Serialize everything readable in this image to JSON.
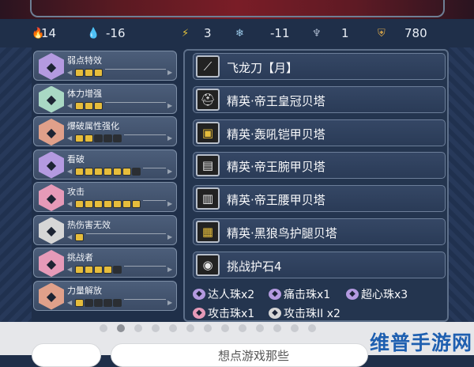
{
  "stats": [
    {
      "icon": "fire-icon",
      "glyph": "🔥",
      "value": "14",
      "color": "#e0413a"
    },
    {
      "icon": "water-icon",
      "glyph": "💧",
      "value": "-16",
      "color": "#4c8fe0"
    },
    {
      "icon": "thunder-icon",
      "glyph": "⚡",
      "value": "3",
      "color": "#e8c53a"
    },
    {
      "icon": "ice-icon",
      "glyph": "❄",
      "value": "-11",
      "color": "#9bc9e8"
    },
    {
      "icon": "dragon-icon",
      "glyph": "♆",
      "value": "1",
      "color": "#a9b6cb"
    },
    {
      "icon": "defense-icon",
      "glyph": "⛨",
      "value": "780",
      "color": "#d6a54a"
    }
  ],
  "skills": [
    {
      "name": "弱点特效",
      "level": 3,
      "max": 3,
      "emblem_color": "#b49ae0"
    },
    {
      "name": "体力增强",
      "level": 3,
      "max": 3,
      "emblem_color": "#a9d8c4"
    },
    {
      "name": "爆破属性强化",
      "level": 2,
      "max": 5,
      "emblem_color": "#e0a08a"
    },
    {
      "name": "看破",
      "level": 6,
      "max": 7,
      "emblem_color": "#b49ae0"
    },
    {
      "name": "攻击",
      "level": 7,
      "max": 7,
      "emblem_color": "#e69ab8"
    },
    {
      "name": "热伤害无效",
      "level": 1,
      "max": 1,
      "emblem_color": "#d6d6d6"
    },
    {
      "name": "挑战者",
      "level": 4,
      "max": 5,
      "emblem_color": "#e69ab8"
    },
    {
      "name": "力量解放",
      "level": 1,
      "max": 5,
      "emblem_color": "#e0a08a"
    }
  ],
  "equipment": [
    {
      "name": "飞龙刀【月】",
      "icon": "long-sword-icon",
      "glyph": "⟋"
    },
    {
      "name": "精英·帝王皇冠贝塔",
      "icon": "helm-icon",
      "glyph": "⛑"
    },
    {
      "name": "精英·轰吼铠甲贝塔",
      "icon": "chest-armor-icon",
      "glyph": "▣"
    },
    {
      "name": "精英·帝王腕甲贝塔",
      "icon": "gauntlet-icon",
      "glyph": "▤"
    },
    {
      "name": "精英·帝王腰甲贝塔",
      "icon": "waist-armor-icon",
      "glyph": "▥"
    },
    {
      "name": "精英·黑狼鸟护腿贝塔",
      "icon": "leg-armor-icon",
      "glyph": "▦"
    },
    {
      "name": "挑战护石4",
      "icon": "charm-icon",
      "glyph": "◉"
    }
  ],
  "jewels": [
    {
      "name": "达人珠x2",
      "icon": "jewel-icon",
      "color": "#b49ae0"
    },
    {
      "name": "痛击珠x1",
      "icon": "jewel-icon",
      "color": "#b49ae0"
    },
    {
      "name": "超心珠x3",
      "icon": "jewel-icon",
      "color": "#b49ae0"
    },
    {
      "name": "攻击珠x1",
      "icon": "jewel-icon",
      "color": "#e69ab8"
    },
    {
      "name": "攻击珠II x2",
      "icon": "jewel-icon",
      "color": "#d6d6d6"
    }
  ],
  "bottom": {
    "search_partial": "想点游戏那些",
    "watermark": "维普手游网"
  },
  "carousel": {
    "count": 13,
    "active": 1
  }
}
